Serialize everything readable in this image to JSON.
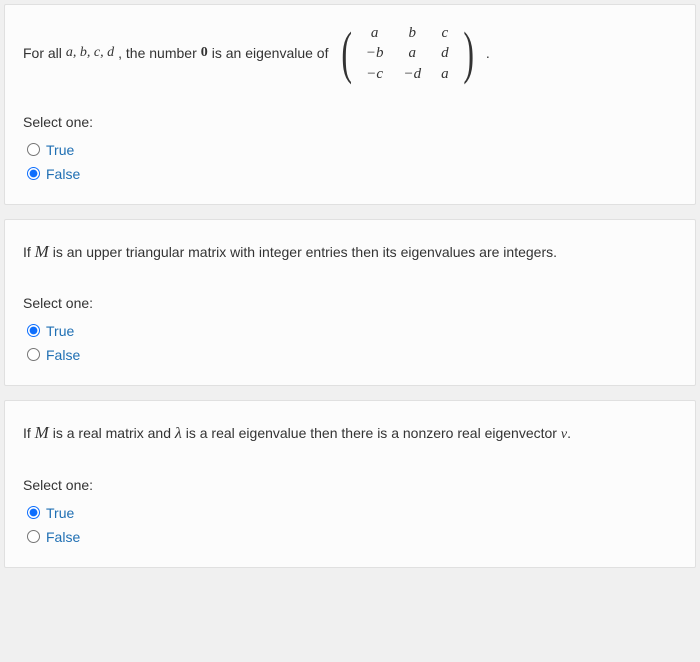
{
  "questions": [
    {
      "text_before": "For all ",
      "vars": "a, b, c, d",
      "text_mid": ", the number ",
      "zero": "0",
      "text_after": " is an eigenvalue of ",
      "matrix": [
        [
          "a",
          "b",
          "c"
        ],
        [
          "−b",
          "a",
          "d"
        ],
        [
          "−c",
          "−d",
          "a"
        ]
      ],
      "period": ".",
      "prompt": "Select one:",
      "true_label": "True",
      "false_label": "False",
      "selected": "false"
    },
    {
      "text_parts": [
        "If ",
        "M",
        " is an upper triangular matrix with integer entries then its eigenvalues are integers."
      ],
      "prompt": "Select one:",
      "true_label": "True",
      "false_label": "False",
      "selected": "true"
    },
    {
      "text_parts": [
        "If ",
        "M",
        " is a real matrix and ",
        "λ",
        " is a real eigenvalue then there is a nonzero real eigenvector ",
        "v",
        "."
      ],
      "prompt": "Select one:",
      "true_label": "True",
      "false_label": "False",
      "selected": "true"
    }
  ]
}
